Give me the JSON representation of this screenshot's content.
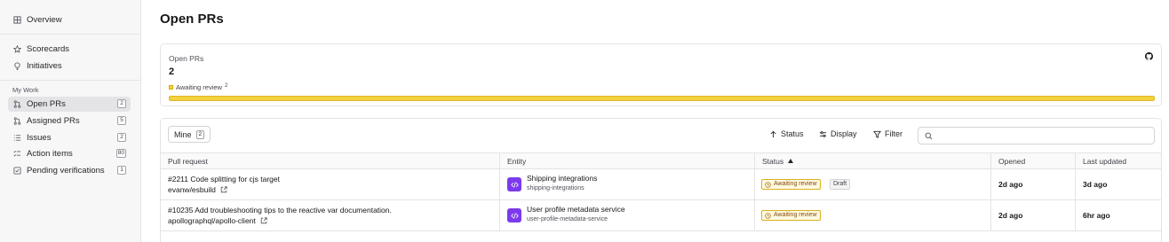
{
  "sidebar": {
    "overview": "Overview",
    "scorecards": "Scorecards",
    "initiatives": "Initiatives",
    "my_work_label": "My Work",
    "items": [
      {
        "label": "Open PRs",
        "count": "2"
      },
      {
        "label": "Assigned PRs",
        "count": "5"
      },
      {
        "label": "Issues",
        "count": "2"
      },
      {
        "label": "Action items",
        "count": "80"
      },
      {
        "label": "Pending verifications",
        "count": "1"
      }
    ]
  },
  "page": {
    "title": "Open PRs"
  },
  "summary": {
    "label": "Open PRs",
    "count": "2",
    "legend_label": "Awaiting review",
    "legend_count": "2",
    "awaiting_review_fraction": 1.0,
    "bar_color": "#f5d13d"
  },
  "toolbar": {
    "mine_label": "Mine",
    "mine_count": "2",
    "status_label": "Status",
    "display_label": "Display",
    "filter_label": "Filter",
    "search_placeholder": ""
  },
  "table": {
    "headers": {
      "pull_request": "Pull request",
      "entity": "Entity",
      "status": "Status",
      "opened": "Opened",
      "last_updated": "Last updated"
    },
    "rows": [
      {
        "title": "#2211 Code splitting for cjs target",
        "repo": "evanw/esbuild",
        "entity_name": "Shipping integrations",
        "entity_id": "shipping-integrations",
        "status": "Awaiting review",
        "draft": "Draft",
        "opened": "2d ago",
        "last_updated": "3d ago"
      },
      {
        "title": "#10235 Add troubleshooting tips to the reactive var documentation.",
        "repo": "apollographql/apollo-client",
        "entity_name": "User profile metadata service",
        "entity_id": "user-profile-metadata-service",
        "status": "Awaiting review",
        "opened": "2d ago",
        "last_updated": "6hr ago"
      }
    ]
  },
  "colors": {
    "accent_purple": "#7c3aed",
    "awaiting_yellow": "#f5d13d",
    "active_sidebar": "#e4e4e7"
  }
}
